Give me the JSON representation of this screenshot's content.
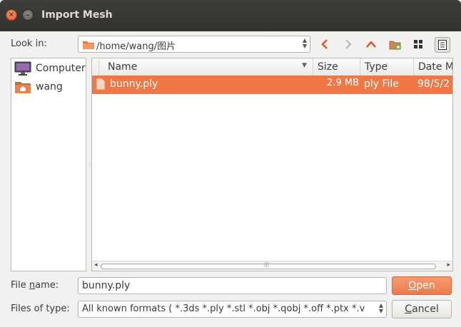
{
  "window": {
    "title": "Import Mesh"
  },
  "look_in": {
    "label": "Look in:",
    "path": "/home/wang/图片"
  },
  "toolbar": {
    "back_icon": "chevron-left-icon",
    "forward_icon": "chevron-right-icon",
    "parent_icon": "chevron-up-icon",
    "new_folder_icon": "new-folder-icon",
    "icon_view_icon": "grid-view-icon",
    "detail_view_icon": "list-view-icon"
  },
  "sidebar": {
    "items": [
      {
        "label": "Computer",
        "icon": "computer-icon"
      },
      {
        "label": "wang",
        "icon": "home-folder-icon"
      }
    ]
  },
  "file_list": {
    "columns": [
      "Name",
      "Size",
      "Type",
      "Date M"
    ],
    "rows": [
      {
        "name": "bunny.ply",
        "size": "2.9 MB",
        "type": "ply File",
        "date": "98/5/2"
      }
    ]
  },
  "file_name": {
    "label_pre": "File ",
    "label_u": "n",
    "label_post": "ame:",
    "value": "bunny.ply"
  },
  "files_of_type": {
    "label": "Files of type:",
    "value": "All known formats ( *.3ds *.ply *.stl *.obj *.qobj *.off *.ptx *.v"
  },
  "buttons": {
    "open_u": "O",
    "open_rest": "pen",
    "cancel_u": "C",
    "cancel_rest": "ancel"
  },
  "colors": {
    "accent": "#f07746",
    "titlebar": "#3c3b37"
  }
}
